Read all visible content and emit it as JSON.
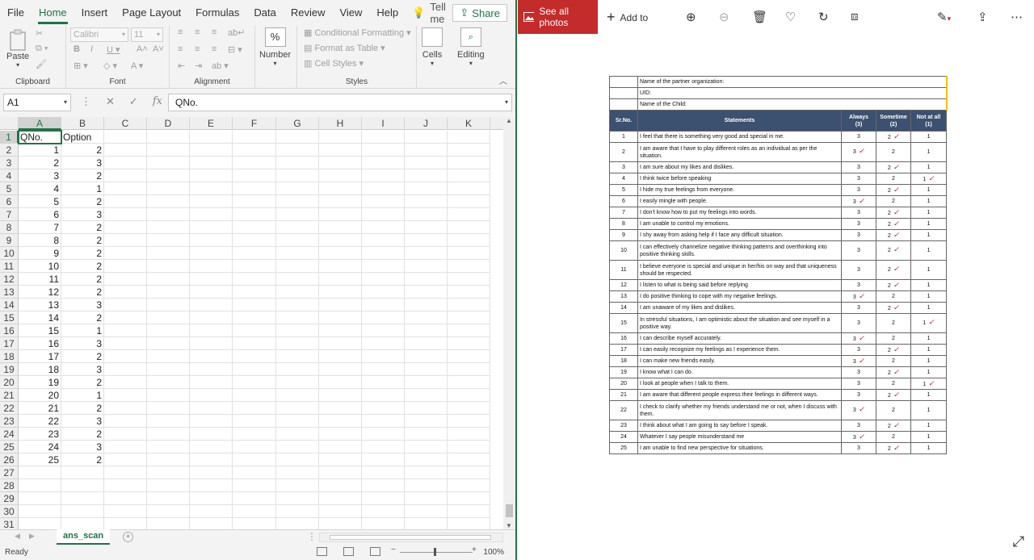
{
  "excel": {
    "tabs": [
      "File",
      "Home",
      "Insert",
      "Page Layout",
      "Formulas",
      "Data",
      "Review",
      "View",
      "Help"
    ],
    "active_tab": "Home",
    "tell_me": "Tell me",
    "share": "Share",
    "ribbon": {
      "paste": "Paste",
      "font_name": "Calibri",
      "font_size": "11",
      "number": "Number",
      "cells": "Cells",
      "editing": "Editing",
      "conditional_formatting": "Conditional Formatting",
      "format_as_table": "Format as Table",
      "cell_styles": "Cell Styles",
      "groups": {
        "clipboard": "Clipboard",
        "font": "Font",
        "alignment": "Alignment",
        "styles": "Styles"
      }
    },
    "name_box": "A1",
    "formula_content": "QNo.",
    "columns": [
      "A",
      "B",
      "C",
      "D",
      "E",
      "F",
      "G",
      "H",
      "I",
      "J",
      "K"
    ],
    "rows": [
      [
        "QNo.",
        "Option"
      ],
      [
        1,
        2
      ],
      [
        2,
        3
      ],
      [
        3,
        2
      ],
      [
        4,
        1
      ],
      [
        5,
        2
      ],
      [
        6,
        3
      ],
      [
        7,
        2
      ],
      [
        8,
        2
      ],
      [
        9,
        2
      ],
      [
        10,
        2
      ],
      [
        11,
        2
      ],
      [
        12,
        2
      ],
      [
        13,
        3
      ],
      [
        14,
        2
      ],
      [
        15,
        1
      ],
      [
        16,
        3
      ],
      [
        17,
        2
      ],
      [
        18,
        3
      ],
      [
        19,
        2
      ],
      [
        20,
        1
      ],
      [
        21,
        2
      ],
      [
        22,
        3
      ],
      [
        23,
        2
      ],
      [
        24,
        3
      ],
      [
        25,
        2
      ]
    ],
    "row_count": 31,
    "sheet_tab": "ans_scan",
    "status": "Ready",
    "zoom": "100%"
  },
  "photos": {
    "see_all": "See all photos",
    "add_to": "Add to",
    "document": {
      "info_rows": [
        "Name of the partner organization:",
        "UID:",
        "Name of the Child:"
      ],
      "headers": [
        "Sr.No.",
        "Statements",
        "Always\n(3)",
        "Sometime\n(2)",
        "Not at all\n(1)"
      ],
      "items": [
        {
          "no": 1,
          "text": "I feel that there is something very good and special in me.",
          "marked": 2
        },
        {
          "no": 2,
          "text": "I am aware that I have to play different roles as an individual as per the situation.",
          "marked": 3
        },
        {
          "no": 3,
          "text": "I am sure about my likes and dislikes.",
          "marked": 2
        },
        {
          "no": 4,
          "text": "I think twice before speaking",
          "marked": 1
        },
        {
          "no": 5,
          "text": "I hide my true feelings from everyone.",
          "marked": 2
        },
        {
          "no": 6,
          "text": "I easily mingle with people.",
          "marked": 3
        },
        {
          "no": 7,
          "text": "I don't know how to put my feelings into words.",
          "marked": 2
        },
        {
          "no": 8,
          "text": "I am unable to control my emotions.",
          "marked": 2
        },
        {
          "no": 9,
          "text": "I shy away from asking help if I face any difficult situation.",
          "marked": 2
        },
        {
          "no": 10,
          "text": "I can effectively channelize negative thinking patterns and overthinking into positive thinking skills.",
          "marked": 2
        },
        {
          "no": 11,
          "text": "I believe everyone is special and unique in her/his on way and that uniqueness should be respected.",
          "marked": 2
        },
        {
          "no": 12,
          "text": "I listen to what is being said before replying",
          "marked": 2
        },
        {
          "no": 13,
          "text": "I do positive thinking to cope with my negative feelings.",
          "marked": 3
        },
        {
          "no": 14,
          "text": "I am unaware of my likes and dislikes.",
          "marked": 2
        },
        {
          "no": 15,
          "text": "In stressful situations, I am optimistic about the situation and see myself in a positive way.",
          "marked": 1
        },
        {
          "no": 16,
          "text": "I can describe myself accurately.",
          "marked": 3
        },
        {
          "no": 17,
          "text": "I can easily recognize my feelings as I experience them.",
          "marked": 2
        },
        {
          "no": 18,
          "text": "I can make new friends easily.",
          "marked": 3
        },
        {
          "no": 19,
          "text": "I know what I can do.",
          "marked": 2
        },
        {
          "no": 20,
          "text": "I look at people when I talk to them.",
          "marked": 1
        },
        {
          "no": 21,
          "text": "I am aware that different people express their feelings in different ways.",
          "marked": 2
        },
        {
          "no": 22,
          "text": "I check to clarify whether my friends understand me or not, when I discuss with them.",
          "marked": 3
        },
        {
          "no": 23,
          "text": "I think about what I am going to say before I speak.",
          "marked": 2
        },
        {
          "no": 24,
          "text": "Whatever I say people misunderstand me",
          "marked": 3
        },
        {
          "no": 25,
          "text": "I am unable to find new perspective for situations.",
          "marked": 2
        }
      ]
    }
  },
  "colors": {
    "excel_green": "#217346",
    "photos_red": "#c42b2b",
    "doc_header": "#3c5070",
    "tick_red": "#c8102e"
  }
}
